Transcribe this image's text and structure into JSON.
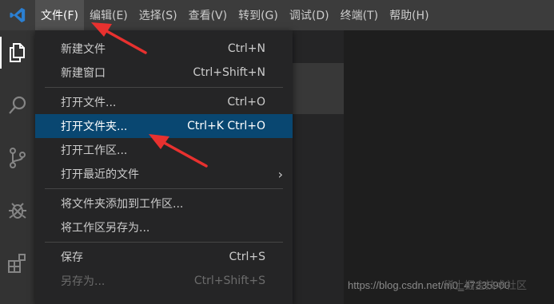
{
  "menubar": {
    "items": [
      {
        "label": "文件(F)",
        "active": true
      },
      {
        "label": "编辑(E)"
      },
      {
        "label": "选择(S)"
      },
      {
        "label": "查看(V)"
      },
      {
        "label": "转到(G)"
      },
      {
        "label": "调试(D)"
      },
      {
        "label": "终端(T)"
      },
      {
        "label": "帮助(H)"
      }
    ]
  },
  "activitybar": {
    "icons": [
      "explorer-icon",
      "search-icon",
      "source-control-icon",
      "debug-icon",
      "extensions-icon"
    ]
  },
  "file_menu": {
    "items": [
      {
        "label": "新建文件",
        "shortcut": "Ctrl+N"
      },
      {
        "label": "新建窗口",
        "shortcut": "Ctrl+Shift+N"
      },
      {
        "label": "打开文件...",
        "shortcut": "Ctrl+O"
      },
      {
        "label": "打开文件夹...",
        "shortcut": "Ctrl+K Ctrl+O",
        "highlighted": true
      },
      {
        "label": "打开工作区..."
      },
      {
        "label": "打开最近的文件",
        "submenu": "›"
      },
      {
        "label": "将文件夹添加到工作区..."
      },
      {
        "label": "将工作区另存为..."
      },
      {
        "label": "保存",
        "shortcut": "Ctrl+S"
      },
      {
        "label": "另存为...",
        "shortcut": "Ctrl+Shift+S",
        "disabled": true
      }
    ]
  },
  "watermark": {
    "url": "https://blog.csdn.net/m0_47335900",
    "overlay": "稀土掘金技术社区"
  },
  "colors": {
    "menubar_bg": "#3c3c3c",
    "activitybar_bg": "#333333",
    "menu_bg": "#252526",
    "highlight_bg": "#094771",
    "vscode_blue": "#2b7fd1",
    "annotation_arrow": "#e8312f"
  }
}
